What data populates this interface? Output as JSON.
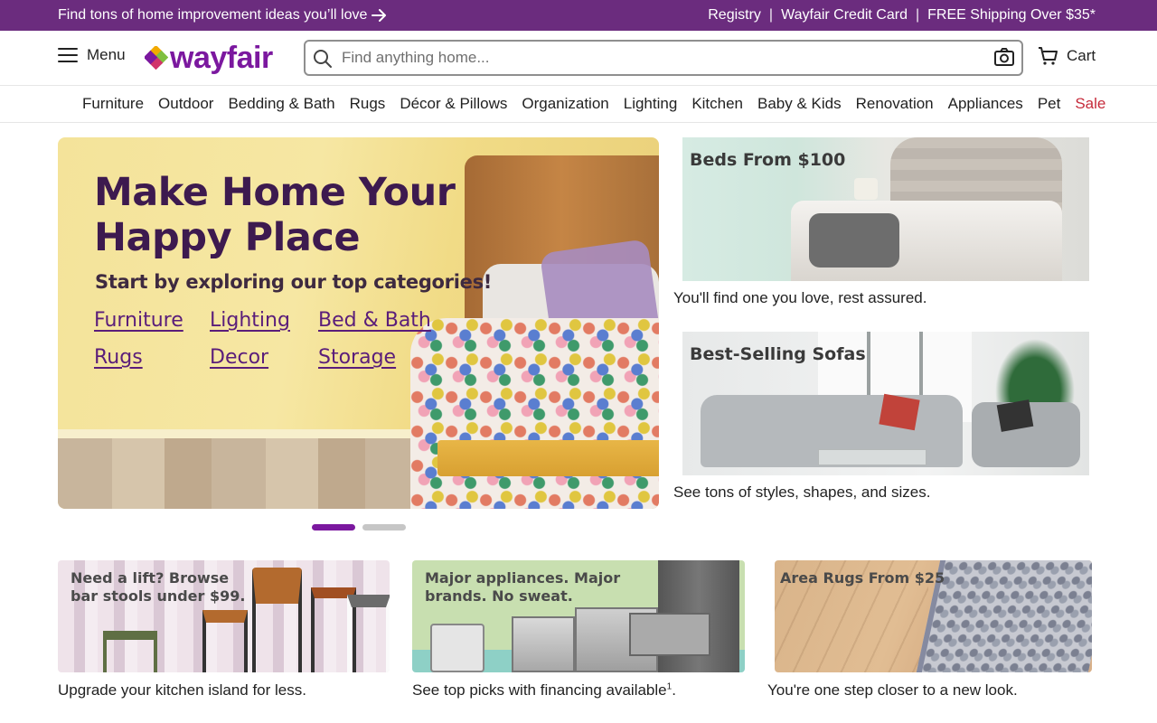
{
  "promo_bar": {
    "left_text": "Find tons of home improvement ideas you’ll love",
    "links": [
      "Registry",
      "Wayfair Credit Card",
      "FREE Shipping Over $35*"
    ],
    "separator": "|",
    "background_color": "#6b2c7e"
  },
  "header": {
    "menu_label": "Menu",
    "logo_text": "wayfair",
    "search_placeholder": "Find anything home...",
    "cart_label": "Cart"
  },
  "categories": [
    "Furniture",
    "Outdoor",
    "Bedding & Bath",
    "Rugs",
    "Décor & Pillows",
    "Organization",
    "Lighting",
    "Kitchen",
    "Baby & Kids",
    "Renovation",
    "Appliances",
    "Pet",
    "Sale"
  ],
  "hero": {
    "title": "Make Home Your Happy Place",
    "subtitle": "Start by exploring our top categories!",
    "links": [
      "Furniture",
      "Lighting",
      "Bed & Bath",
      "Rugs",
      "Decor",
      "Storage"
    ],
    "carousel_active_index": 0,
    "carousel_count": 2
  },
  "side_promos": [
    {
      "image_title": "Beds From $100",
      "caption": "You'll find one you love, rest assured."
    },
    {
      "image_title": "Best-Selling Sofas",
      "caption": "See tons of styles, shapes, and sizes."
    }
  ],
  "bottom_promos": [
    {
      "image_title": "Need a lift? Browse bar stools under $99.",
      "caption": "Upgrade your kitchen island for less.",
      "footnote": ""
    },
    {
      "image_title": "Major appliances. Major brands. No sweat.",
      "caption": "See top picks with financing available",
      "footnote": "1",
      "caption_end": "."
    },
    {
      "image_title": "Area Rugs From $25",
      "caption": "You're one step closer to a new look.",
      "footnote": ""
    }
  ],
  "colors": {
    "brand_purple": "#7b189f",
    "sale_red": "#c62b3b"
  }
}
